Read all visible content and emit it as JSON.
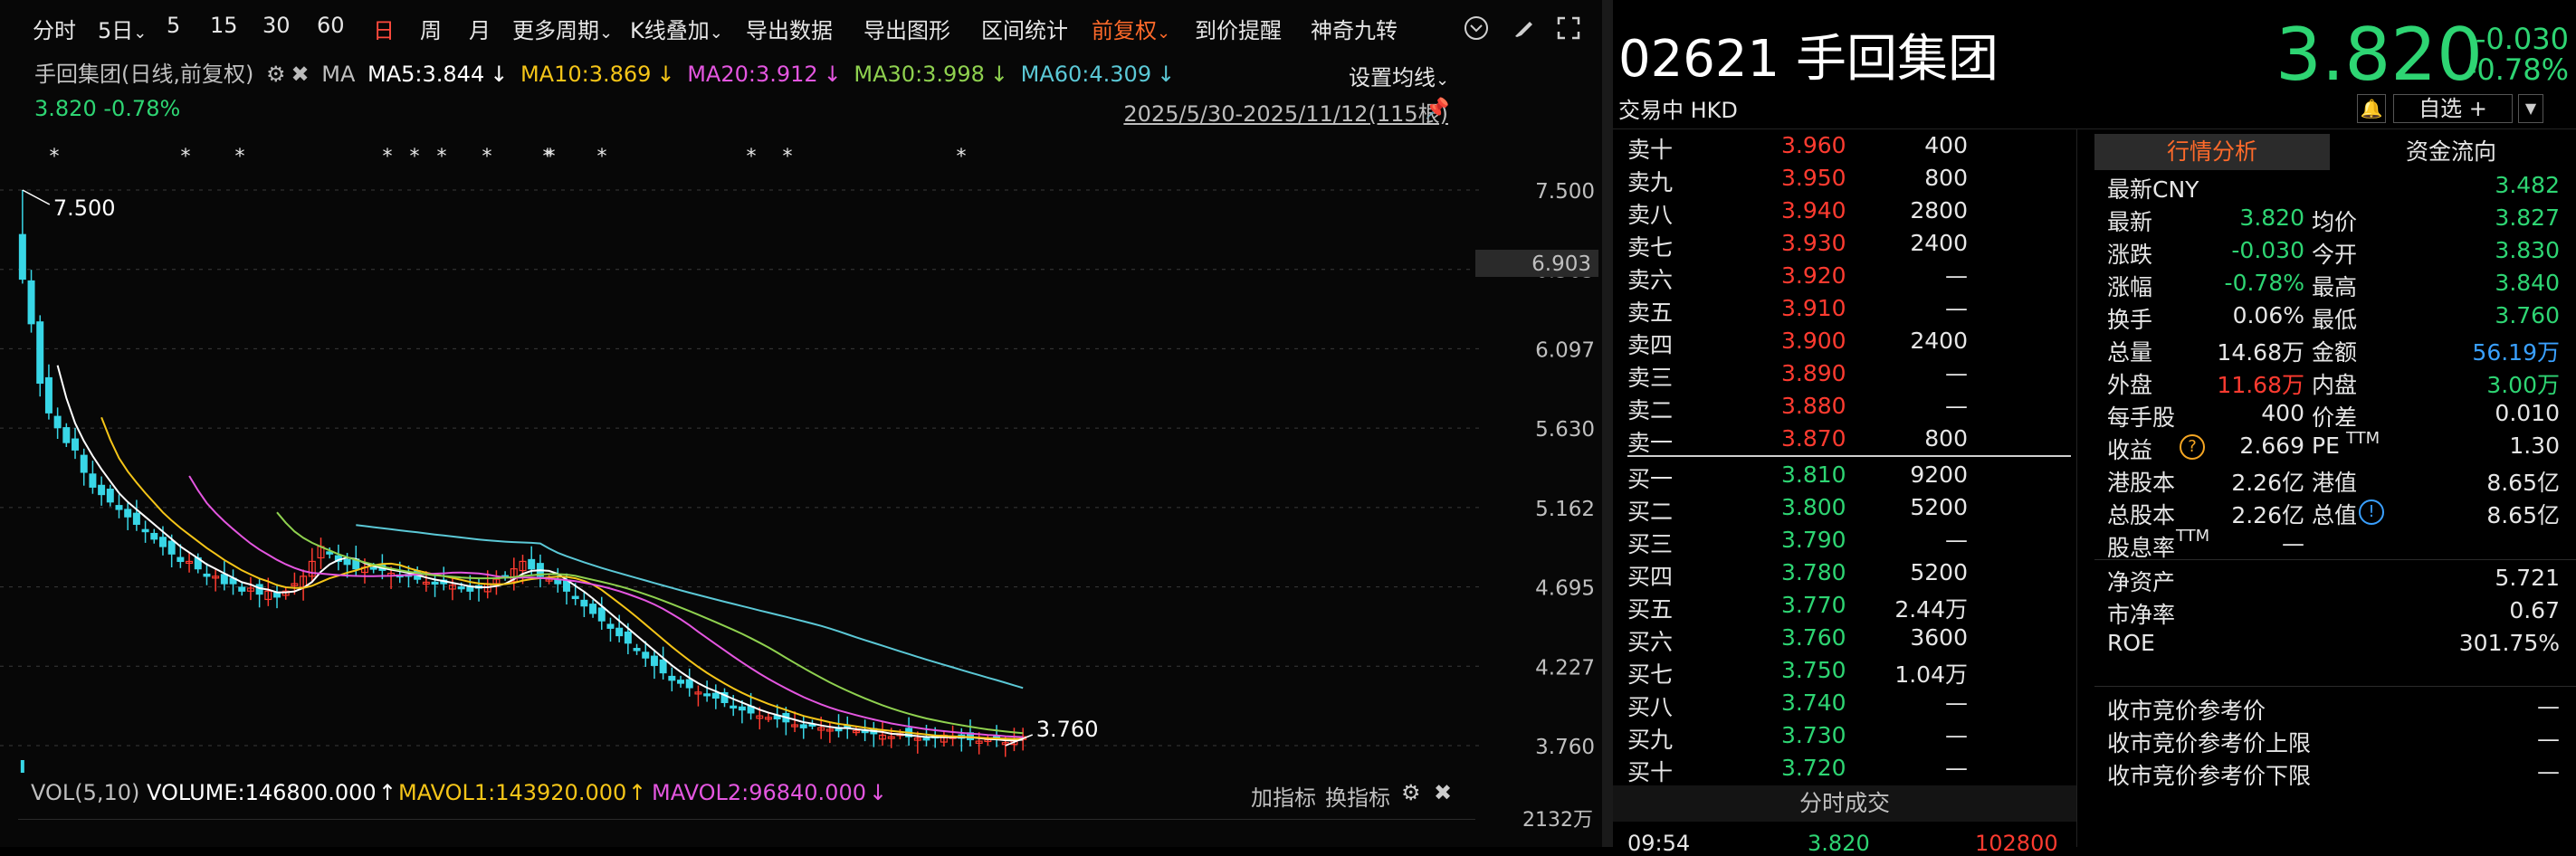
{
  "toolbar": {
    "items": [
      "分时",
      "5日",
      "5",
      "15",
      "30",
      "60",
      "日",
      "周",
      "月",
      "更多周期",
      "K线叠加",
      "导出数据",
      "导出图形",
      "区间统计",
      "前复权",
      "到价提醒",
      "神奇九转"
    ],
    "dropdown_suffix": "⌄"
  },
  "info": {
    "name": "手回集团(日线,前复权)",
    "ma_label": "MA",
    "ma5": "MA5:3.844",
    "ma10": "MA10:3.869",
    "ma20": "MA20:3.912",
    "ma30": "MA30:3.998",
    "ma60": "MA60:4.309",
    "down_arrow": "↓",
    "price": "3.820",
    "change_pct": "-0.78%",
    "date_range": "2025/5/30-2025/11/12(115根)",
    "set_ma": "设置均线"
  },
  "colors": {
    "ma5": "#ffffff",
    "ma10": "#f5c518",
    "ma20": "#e456e0",
    "ma30": "#8fd14f",
    "ma60": "#5bc8d6",
    "up": "#ff3b30",
    "down": "#2ed573",
    "cyan_candle": "#38d6e6"
  },
  "chart_data": {
    "type": "candlestick",
    "y_ticks": [
      "7.500",
      "6.565",
      "6.097",
      "5.630",
      "5.162",
      "4.695",
      "4.227",
      "3.760"
    ],
    "cursor_price": "6.903",
    "max_label": "7.500",
    "min_label": "3.760",
    "ylim": [
      3.76,
      7.5
    ],
    "vol_axis_label": "2132万",
    "closes": [
      6.9,
      6.6,
      6.2,
      6.0,
      5.9,
      5.8,
      5.75,
      5.6,
      5.5,
      5.45,
      5.4,
      5.35,
      5.3,
      5.25,
      5.2,
      5.15,
      5.1,
      5.05,
      5.0,
      5.0,
      4.95,
      4.9,
      4.9,
      4.85,
      4.85,
      4.8,
      4.82,
      4.78,
      4.8,
      4.76,
      4.8,
      4.85,
      4.9,
      5.0,
      5.1,
      5.05,
      5.0,
      4.98,
      4.95,
      4.96,
      4.95,
      4.94,
      4.92,
      4.9,
      4.9,
      4.88,
      4.86,
      4.85,
      4.85,
      4.84,
      4.82,
      4.8,
      4.82,
      4.85,
      4.88,
      4.9,
      4.95,
      5.0,
      4.95,
      4.9,
      4.88,
      4.85,
      4.8,
      4.75,
      4.7,
      4.65,
      4.6,
      4.55,
      4.5,
      4.45,
      4.4,
      4.35,
      4.3,
      4.25,
      4.2,
      4.18,
      4.15,
      4.12,
      4.1,
      4.08,
      4.05,
      4.02,
      4.0,
      3.98,
      3.96,
      3.95,
      3.94,
      3.92,
      3.9,
      3.88,
      3.9,
      3.88,
      3.87,
      3.86,
      3.88,
      3.86,
      3.85,
      3.84,
      3.83,
      3.82,
      3.84,
      3.82,
      3.81,
      3.8,
      3.82,
      3.83,
      3.82,
      3.81,
      3.8,
      3.79,
      3.8,
      3.81,
      3.78,
      3.79,
      3.82
    ],
    "ma60_start_index": 38
  },
  "volume_row": {
    "label": "VOL(5,10)",
    "volume": "VOLUME:146800.000",
    "up_arrow": "↑",
    "mavol1": "MAVOL1:143920.000",
    "mavol2": "MAVOL2:96840.000",
    "down_arrow": "↓",
    "add_indicator": "加指标",
    "change_indicator": "换指标"
  },
  "stock": {
    "code_name": "02621 手回集团",
    "status": "交易中 HKD",
    "price": "3.820",
    "change": "-0.030",
    "change_pct": "-0.78%",
    "watchlist_btn": "自选 +"
  },
  "orderbook": {
    "asks": [
      {
        "label": "卖十",
        "price": "3.960",
        "vol": "400"
      },
      {
        "label": "卖九",
        "price": "3.950",
        "vol": "800"
      },
      {
        "label": "卖八",
        "price": "3.940",
        "vol": "2800"
      },
      {
        "label": "卖七",
        "price": "3.930",
        "vol": "2400"
      },
      {
        "label": "卖六",
        "price": "3.920",
        "vol": "—"
      },
      {
        "label": "卖五",
        "price": "3.910",
        "vol": "—"
      },
      {
        "label": "卖四",
        "price": "3.900",
        "vol": "2400"
      },
      {
        "label": "卖三",
        "price": "3.890",
        "vol": "—"
      },
      {
        "label": "卖二",
        "price": "3.880",
        "vol": "—"
      },
      {
        "label": "卖一",
        "price": "3.870",
        "vol": "800"
      }
    ],
    "bids": [
      {
        "label": "买一",
        "price": "3.810",
        "vol": "9200"
      },
      {
        "label": "买二",
        "price": "3.800",
        "vol": "5200"
      },
      {
        "label": "买三",
        "price": "3.790",
        "vol": "—"
      },
      {
        "label": "买四",
        "price": "3.780",
        "vol": "5200"
      },
      {
        "label": "买五",
        "price": "3.770",
        "vol": "2.44万"
      },
      {
        "label": "买六",
        "price": "3.760",
        "vol": "3600"
      },
      {
        "label": "买七",
        "price": "3.750",
        "vol": "1.04万"
      },
      {
        "label": "买八",
        "price": "3.740",
        "vol": "—"
      },
      {
        "label": "买九",
        "price": "3.730",
        "vol": "—"
      },
      {
        "label": "买十",
        "price": "3.720",
        "vol": "—"
      }
    ],
    "tick_title": "分时成交",
    "tick_row": {
      "time": "09:54",
      "price": "3.820",
      "vol": "102800"
    }
  },
  "quote": {
    "tab_active": "行情分析",
    "tab_other": "资金流向",
    "cny_label": "最新CNY",
    "cny_value": "3.482",
    "rows": [
      {
        "k1": "最新",
        "v1": "3.820",
        "c1": "green",
        "k2": "均价",
        "v2": "3.827",
        "c2": "green"
      },
      {
        "k1": "涨跌",
        "v1": "-0.030",
        "c1": "green",
        "k2": "今开",
        "v2": "3.830",
        "c2": "green"
      },
      {
        "k1": "涨幅",
        "v1": "-0.78%",
        "c1": "green",
        "k2": "最高",
        "v2": "3.840",
        "c2": "green"
      },
      {
        "k1": "换手",
        "v1": "0.06%",
        "c1": "white",
        "k2": "最低",
        "v2": "3.760",
        "c2": "green"
      },
      {
        "k1": "总量",
        "v1": "14.68万",
        "c1": "white",
        "k2": "金额",
        "v2": "56.19万",
        "c2": "blue"
      },
      {
        "k1": "外盘",
        "v1": "11.68万",
        "c1": "red",
        "k2": "内盘",
        "v2": "3.00万",
        "c2": "green"
      },
      {
        "k1": "每手股",
        "v1": "400",
        "c1": "white",
        "k2": "价差",
        "v2": "0.010",
        "c2": "white"
      },
      {
        "k1": "收益",
        "v1": "2.669",
        "c1": "white",
        "k2": "PE",
        "v2": "1.30",
        "c2": "white"
      },
      {
        "k1": "港股本",
        "v1": "2.26亿",
        "c1": "white",
        "k2": "港值",
        "v2": "8.65亿",
        "c2": "white"
      },
      {
        "k1": "总股本",
        "v1": "2.26亿",
        "c1": "white",
        "k2": "总值",
        "v2": "8.65亿",
        "c2": "white"
      },
      {
        "k1": "股息率",
        "v1": "—",
        "c1": "white",
        "k2": "",
        "v2": "",
        "c2": "white"
      }
    ],
    "ttm": "TTM",
    "help_glyph": "?",
    "info_glyph": "!",
    "net_assets_label": "净资产",
    "net_assets": "5.721",
    "pb_label": "市净率",
    "pb": "0.67",
    "roe_label": "ROE",
    "roe": "301.75%",
    "auction_ref": "收市竞价参考价",
    "auction_upper": "收市竞价参考价上限",
    "auction_lower": "收市竞价参考价下限",
    "dash": "—"
  }
}
